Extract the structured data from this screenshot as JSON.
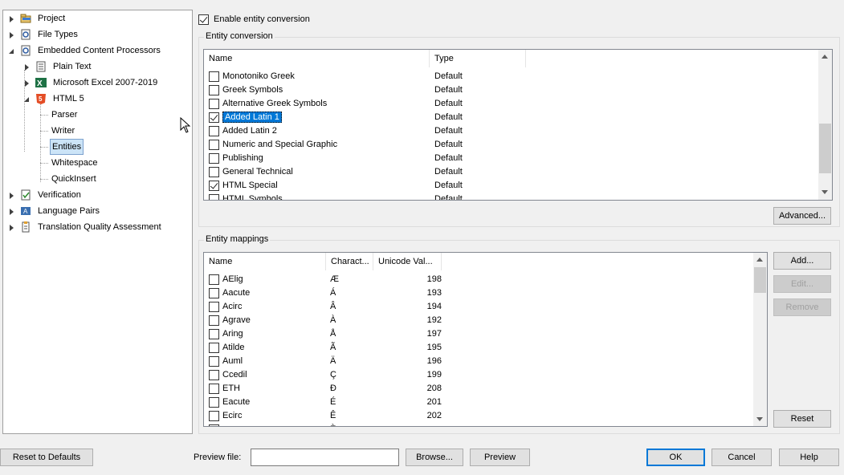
{
  "tree": {
    "items": [
      {
        "label": "Project",
        "icon": "project-icon"
      },
      {
        "label": "File Types",
        "icon": "file-types-icon"
      },
      {
        "label": "Embedded Content Processors",
        "icon": "embedded-content-icon"
      },
      {
        "label": "Plain Text",
        "icon": "plain-text-icon"
      },
      {
        "label": "Microsoft Excel 2007-2019",
        "icon": "excel-icon"
      },
      {
        "label": "HTML 5",
        "icon": "html5-icon"
      },
      {
        "label": "Parser"
      },
      {
        "label": "Writer"
      },
      {
        "label": "Entities"
      },
      {
        "label": "Whitespace"
      },
      {
        "label": "QuickInsert"
      },
      {
        "label": "Verification",
        "icon": "verification-icon"
      },
      {
        "label": "Language Pairs",
        "icon": "language-pairs-icon"
      },
      {
        "label": "Translation Quality Assessment",
        "icon": "tqa-icon"
      }
    ]
  },
  "enable_conversion": {
    "label": "Enable entity conversion",
    "checked": true
  },
  "entity_conversion": {
    "title": "Entity conversion",
    "columns": [
      "Name",
      "Type"
    ],
    "rows": [
      {
        "name": "Monotoniko Greek",
        "type": "Default",
        "checked": false
      },
      {
        "name": "Greek Symbols",
        "type": "Default",
        "checked": false
      },
      {
        "name": "Alternative Greek Symbols",
        "type": "Default",
        "checked": false
      },
      {
        "name": "Added Latin 1",
        "type": "Default",
        "checked": true,
        "selected": true
      },
      {
        "name": "Added Latin 2",
        "type": "Default",
        "checked": false
      },
      {
        "name": "Numeric and Special Graphic",
        "type": "Default",
        "checked": false
      },
      {
        "name": "Publishing",
        "type": "Default",
        "checked": false
      },
      {
        "name": "General Technical",
        "type": "Default",
        "checked": false
      },
      {
        "name": "HTML Special",
        "type": "Default",
        "checked": true
      },
      {
        "name": "HTML Symbols",
        "type": "Default",
        "checked": false
      }
    ],
    "advanced_label": "Advanced..."
  },
  "entity_mappings": {
    "title": "Entity mappings",
    "columns": [
      "Name",
      "Charact...",
      "Unicode Val..."
    ],
    "rows": [
      {
        "name": "AElig",
        "char": "Æ",
        "code": "198"
      },
      {
        "name": "Aacute",
        "char": "Á",
        "code": "193"
      },
      {
        "name": "Acirc",
        "char": "Â",
        "code": "194"
      },
      {
        "name": "Agrave",
        "char": "À",
        "code": "192"
      },
      {
        "name": "Aring",
        "char": "Å",
        "code": "197"
      },
      {
        "name": "Atilde",
        "char": "Ã",
        "code": "195"
      },
      {
        "name": "Auml",
        "char": "Ä",
        "code": "196"
      },
      {
        "name": "Ccedil",
        "char": "Ç",
        "code": "199"
      },
      {
        "name": "ETH",
        "char": "Ð",
        "code": "208"
      },
      {
        "name": "Eacute",
        "char": "É",
        "code": "201"
      },
      {
        "name": "Ecirc",
        "char": "Ê",
        "code": "202"
      },
      {
        "name": "",
        "char": "È",
        "code": ""
      }
    ],
    "add_label": "Add...",
    "edit_label": "Edit...",
    "remove_label": "Remove",
    "reset_label": "Reset"
  },
  "footer": {
    "reset_defaults_label": "Reset to Defaults",
    "preview_file_label": "Preview file:",
    "preview_file_value": "",
    "browse_label": "Browse...",
    "preview_label": "Preview",
    "ok_label": "OK",
    "cancel_label": "Cancel",
    "help_label": "Help"
  }
}
